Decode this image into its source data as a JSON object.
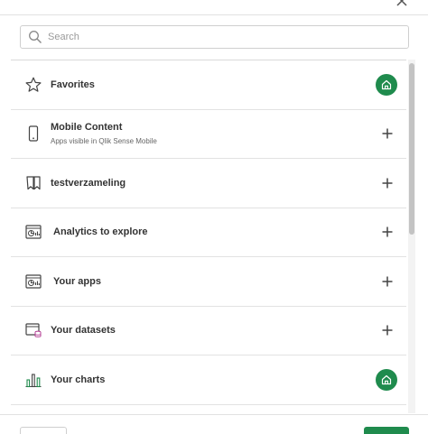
{
  "search": {
    "placeholder": "Search"
  },
  "items": [
    {
      "label": "Favorites",
      "icon": "star-icon",
      "action": "home"
    },
    {
      "label": "Mobile Content",
      "subtitle": "Apps visible in Qlik Sense Mobile",
      "icon": "mobile-icon",
      "action": "add"
    },
    {
      "label": "testverzameling",
      "icon": "bookmark-icon",
      "action": "add"
    },
    {
      "label": "Analytics to explore",
      "icon": "app-icon",
      "action": "add"
    },
    {
      "label": "Your apps",
      "icon": "app-icon",
      "action": "add"
    },
    {
      "label": "Your datasets",
      "icon": "dataset-icon",
      "action": "add"
    },
    {
      "label": "Your charts",
      "icon": "chart-icon",
      "action": "home"
    }
  ],
  "colors": {
    "accent": "#1f8b4d",
    "border": "#e2e2e2",
    "text": "#333333"
  }
}
